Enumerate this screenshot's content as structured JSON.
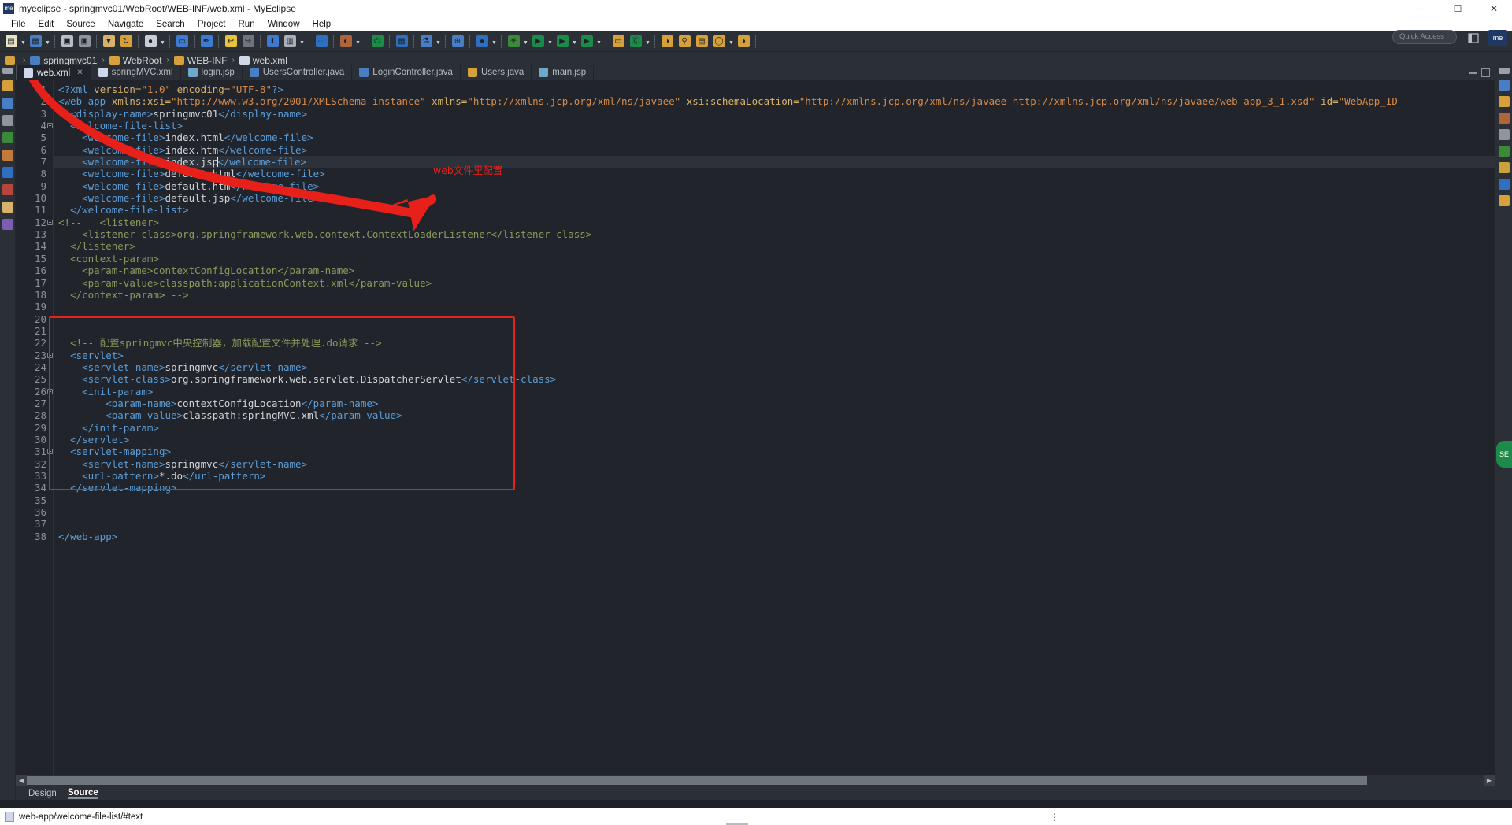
{
  "window": {
    "title": "myeclipse - springmvc01/WebRoot/WEB-INF/web.xml - MyEclipse",
    "app_badge": "me",
    "minimize": "─",
    "maximize": "☐",
    "close": "✕"
  },
  "menu": {
    "items": [
      "File",
      "Edit",
      "Source",
      "Navigate",
      "Search",
      "Project",
      "Run",
      "Window",
      "Help"
    ]
  },
  "toolbar": {
    "quick_access_placeholder": "Quick Access",
    "perspective_label": "me",
    "groups": [
      {
        "buttons": [
          {
            "name": "new-wizard-button",
            "glyph": "▤",
            "color": "#e8e2c8",
            "arrow": true
          },
          {
            "name": "new-web-project-button",
            "glyph": "▦",
            "color": "#4a7ec4",
            "arrow": true
          }
        ]
      },
      {
        "buttons": [
          {
            "name": "save-button",
            "glyph": "▣",
            "color": "#b9bec4",
            "arrow": false
          },
          {
            "name": "save-all-button",
            "glyph": "▣",
            "color": "#8f959b",
            "arrow": false
          }
        ]
      },
      {
        "buttons": [
          {
            "name": "export-button",
            "glyph": "▼",
            "color": "#d6b26a",
            "arrow": false
          },
          {
            "name": "refresh-button",
            "glyph": "↻",
            "color": "#d6a13a",
            "arrow": false
          }
        ]
      },
      {
        "buttons": [
          {
            "name": "user-profile-button",
            "glyph": "●",
            "color": "#c9ced4",
            "arrow": true
          }
        ]
      },
      {
        "buttons": [
          {
            "name": "open-perspective-button",
            "glyph": "▭",
            "color": "#3f7ad1",
            "arrow": false
          }
        ]
      },
      {
        "buttons": [
          {
            "name": "pen-button",
            "glyph": "✒",
            "color": "#3f7ad1",
            "arrow": false
          }
        ]
      },
      {
        "buttons": [
          {
            "name": "undo-button",
            "glyph": "↩",
            "color": "#e8c23a",
            "arrow": false
          },
          {
            "name": "redo-button",
            "glyph": "↪",
            "color": "#6e757d",
            "arrow": false
          }
        ]
      },
      {
        "buttons": [
          {
            "name": "upload-button",
            "glyph": "⬆",
            "color": "#3f7ad1",
            "arrow": false
          },
          {
            "name": "server-button",
            "glyph": "▥",
            "color": "#a9b0b8",
            "arrow": true
          }
        ]
      },
      {
        "buttons": [
          {
            "name": "console-button",
            "glyph": "⋯",
            "color": "#2f6fbf",
            "arrow": false
          }
        ]
      },
      {
        "buttons": [
          {
            "name": "palette-button",
            "glyph": "◐",
            "color": "#b0643a",
            "arrow": true
          }
        ]
      },
      {
        "buttons": [
          {
            "name": "power-button",
            "glyph": "⏻",
            "color": "#1d8a4a",
            "arrow": false
          }
        ]
      },
      {
        "buttons": [
          {
            "name": "layout-button",
            "glyph": "▦",
            "color": "#2f6fbf",
            "arrow": false
          }
        ]
      },
      {
        "buttons": [
          {
            "name": "test-button",
            "glyph": "⚗",
            "color": "#4a7ec4",
            "arrow": true
          }
        ]
      },
      {
        "buttons": [
          {
            "name": "web-button",
            "glyph": "⊕",
            "color": "#4a7ec4",
            "arrow": false
          }
        ]
      },
      {
        "buttons": [
          {
            "name": "search-web-button",
            "glyph": "●",
            "color": "#2f6fbf",
            "arrow": true
          }
        ]
      },
      {
        "buttons": [
          {
            "name": "debug-button",
            "glyph": "☣",
            "color": "#3a8a3a",
            "arrow": true
          },
          {
            "name": "run-button",
            "glyph": "▶",
            "color": "#1d8a4a",
            "arrow": true
          },
          {
            "name": "run-external-button",
            "glyph": "▶",
            "color": "#1d8a4a",
            "arrow": true
          },
          {
            "name": "profile-button",
            "glyph": "▶",
            "color": "#1d8a4a",
            "arrow": true
          }
        ]
      },
      {
        "buttons": [
          {
            "name": "new-folder-button",
            "glyph": "▭",
            "color": "#d6a13a",
            "arrow": false
          },
          {
            "name": "new-class-button",
            "glyph": "Ⓒ",
            "color": "#1d8a4a",
            "arrow": true
          }
        ]
      },
      {
        "buttons": [
          {
            "name": "open-type-button",
            "glyph": "◑",
            "color": "#d6a13a",
            "arrow": false
          },
          {
            "name": "search-button",
            "glyph": "⚲",
            "color": "#d6a13a",
            "arrow": false
          },
          {
            "name": "clipboard-button",
            "glyph": "▤",
            "color": "#d6a13a",
            "arrow": false
          },
          {
            "name": "open-resource-button",
            "glyph": "◯",
            "color": "#d6a13a",
            "arrow": true
          },
          {
            "name": "last-button",
            "glyph": "◑",
            "color": "#d6a13a",
            "arrow": false
          }
        ]
      }
    ]
  },
  "breadcrumb": {
    "items": [
      {
        "label": "",
        "icon": "folder-icon"
      },
      {
        "label": "springmvc01",
        "icon": "project-icon"
      },
      {
        "label": "WebRoot",
        "icon": "folder-icon"
      },
      {
        "label": "WEB-INF",
        "icon": "folder-icon"
      },
      {
        "label": "web.xml",
        "icon": "xml-file-icon"
      }
    ],
    "separator": "›"
  },
  "editor_tabs": {
    "close_glyph": "✕",
    "items": [
      {
        "label": "web.xml",
        "icon": "xml-file-icon",
        "active": true,
        "closable": true
      },
      {
        "label": "springMVC.xml",
        "icon": "xml-file-icon",
        "active": false,
        "closable": false
      },
      {
        "label": "login.jsp",
        "icon": "jsp-file-icon",
        "active": false,
        "closable": false
      },
      {
        "label": "UsersController.java",
        "icon": "java-file-icon",
        "active": false,
        "closable": false
      },
      {
        "label": "LoginController.java",
        "icon": "java-file-icon",
        "active": false,
        "closable": false
      },
      {
        "label": "Users.java",
        "icon": "java-warning-file-icon",
        "active": false,
        "closable": false
      },
      {
        "label": "main.jsp",
        "icon": "jsp-file-icon",
        "active": false,
        "closable": false
      }
    ]
  },
  "code": {
    "current_line": 7,
    "lines": [
      {
        "n": 1,
        "fold": false,
        "html": "<span class='tag'>&lt;?xml</span> <span class='attr'>version=</span><span class='val'>\"1.0\"</span> <span class='attr'>encoding=</span><span class='val'>\"UTF-8\"</span><span class='tag'>?&gt;</span>"
      },
      {
        "n": 2,
        "fold": true,
        "html": "<span class='tag'>&lt;web-app</span> <span class='attr'>xmlns:xsi=</span><span class='val'>\"http://www.w3.org/2001/XMLSchema-instance\"</span> <span class='attr'>xmlns=</span><span class='val'>\"http://xmlns.jcp.org/xml/ns/javaee\"</span> <span class='attr'>xsi:schemaLocation=</span><span class='val'>\"http://xmlns.jcp.org/xml/ns/javaee http://xmlns.jcp.org/xml/ns/javaee/web-app_3_1.xsd\"</span> <span class='attr'>id=</span><span class='val'>\"WebApp_ID</span>"
      },
      {
        "n": 3,
        "fold": false,
        "html": "  <span class='tag'>&lt;display-name&gt;</span><span class='txt'>springmvc01</span><span class='tag'>&lt;/display-name&gt;</span>"
      },
      {
        "n": 4,
        "fold": true,
        "html": "  <span class='tag'>&lt;welcome-file-list&gt;</span>"
      },
      {
        "n": 5,
        "fold": false,
        "html": "    <span class='tag'>&lt;welcome-file&gt;</span><span class='txt'>index.html</span><span class='tag'>&lt;/welcome-file&gt;</span>"
      },
      {
        "n": 6,
        "fold": false,
        "html": "    <span class='tag'>&lt;welcome-file&gt;</span><span class='txt'>index.htm</span><span class='tag'>&lt;/welcome-file&gt;</span>"
      },
      {
        "n": 7,
        "fold": false,
        "html": "    <span class='tag'>&lt;welcome-file&gt;</span><span class='txt'>index.jsp</span><span class='caret'></span><span class='tag'>&lt;/welcome-file&gt;</span>"
      },
      {
        "n": 8,
        "fold": false,
        "html": "    <span class='tag'>&lt;welcome-file&gt;</span><span class='txt'>default.html</span><span class='tag'>&lt;/welcome-file&gt;</span>"
      },
      {
        "n": 9,
        "fold": false,
        "html": "    <span class='tag'>&lt;welcome-file&gt;</span><span class='txt'>default.htm</span><span class='tag'>&lt;/welcome-file&gt;</span>"
      },
      {
        "n": 10,
        "fold": false,
        "html": "    <span class='tag'>&lt;welcome-file&gt;</span><span class='txt'>default.jsp</span><span class='tag'>&lt;/welcome-file&gt;</span>"
      },
      {
        "n": 11,
        "fold": false,
        "html": "  <span class='tag'>&lt;/welcome-file-list&gt;</span>"
      },
      {
        "n": 12,
        "fold": true,
        "html": "<span class='cmt'>&lt;!--   &lt;listener&gt;</span>"
      },
      {
        "n": 13,
        "fold": false,
        "html": "    <span class='cmt'>&lt;listener-class&gt;org.springframework.web.context.ContextLoaderListener&lt;/listener-class&gt;</span>"
      },
      {
        "n": 14,
        "fold": false,
        "html": "  <span class='cmt'>&lt;/listener&gt;</span>"
      },
      {
        "n": 15,
        "fold": false,
        "html": "  <span class='cmt'>&lt;context-param&gt;</span>"
      },
      {
        "n": 16,
        "fold": false,
        "html": "    <span class='cmt'>&lt;param-name&gt;contextConfigLocation&lt;/param-name&gt;</span>"
      },
      {
        "n": 17,
        "fold": false,
        "html": "    <span class='cmt'>&lt;param-value&gt;classpath:applicationContext.xml&lt;/param-value&gt;</span>"
      },
      {
        "n": 18,
        "fold": false,
        "html": "  <span class='cmt'>&lt;/context-param&gt; --&gt;</span>"
      },
      {
        "n": 19,
        "fold": false,
        "html": ""
      },
      {
        "n": 20,
        "fold": false,
        "html": ""
      },
      {
        "n": 21,
        "fold": false,
        "html": ""
      },
      {
        "n": 22,
        "fold": false,
        "html": "  <span class='cmt'>&lt;!-- 配置springmvc中央控制器，加载配置文件并处理.do请求 --&gt;</span>"
      },
      {
        "n": 23,
        "fold": true,
        "html": "  <span class='tag'>&lt;servlet&gt;</span>"
      },
      {
        "n": 24,
        "fold": false,
        "html": "    <span class='tag'>&lt;servlet-name&gt;</span><span class='txt'>springmvc</span><span class='tag'>&lt;/servlet-name&gt;</span>"
      },
      {
        "n": 25,
        "fold": false,
        "html": "    <span class='tag'>&lt;servlet-class&gt;</span><span class='txt'>org.springframework.web.servlet.DispatcherServlet</span><span class='tag'>&lt;/servlet-class&gt;</span>"
      },
      {
        "n": 26,
        "fold": true,
        "html": "    <span class='tag'>&lt;init-param&gt;</span>"
      },
      {
        "n": 27,
        "fold": false,
        "html": "        <span class='tag'>&lt;param-name&gt;</span><span class='txt'>contextConfigLocation</span><span class='tag'>&lt;/param-name&gt;</span>"
      },
      {
        "n": 28,
        "fold": false,
        "html": "        <span class='tag'>&lt;param-value&gt;</span><span class='txt'>classpath:springMVC.xml</span><span class='tag'>&lt;/param-value&gt;</span>"
      },
      {
        "n": 29,
        "fold": false,
        "html": "    <span class='tag'>&lt;/init-param&gt;</span>"
      },
      {
        "n": 30,
        "fold": false,
        "html": "  <span class='tag'>&lt;/servlet&gt;</span>"
      },
      {
        "n": 31,
        "fold": true,
        "html": "  <span class='tag'>&lt;servlet-mapping&gt;</span>"
      },
      {
        "n": 32,
        "fold": false,
        "html": "    <span class='tag'>&lt;servlet-name&gt;</span><span class='txt'>springmvc</span><span class='tag'>&lt;/servlet-name&gt;</span>"
      },
      {
        "n": 33,
        "fold": false,
        "html": "    <span class='tag'>&lt;url-pattern&gt;</span><span class='txt'>*.do</span><span class='tag'>&lt;/url-pattern&gt;</span>"
      },
      {
        "n": 34,
        "fold": false,
        "html": "  <span class='tag'>&lt;/servlet-mapping&gt;</span>"
      },
      {
        "n": 35,
        "fold": false,
        "html": ""
      },
      {
        "n": 36,
        "fold": false,
        "html": ""
      },
      {
        "n": 37,
        "fold": false,
        "html": ""
      },
      {
        "n": 38,
        "fold": false,
        "html": "<span class='tag'>&lt;/web-app&gt;</span>"
      }
    ]
  },
  "annotation": {
    "label": "web文件里配置",
    "color": "#e8201a"
  },
  "bottom_tabs": {
    "items": [
      {
        "label": "Design",
        "active": false
      },
      {
        "label": "Source",
        "active": true
      }
    ]
  },
  "status": {
    "path": "web-app/welcome-file-list/#text",
    "overflow": "⋮"
  },
  "scrollbar": {
    "left_arrow": "◀",
    "right_arrow": "▶"
  }
}
